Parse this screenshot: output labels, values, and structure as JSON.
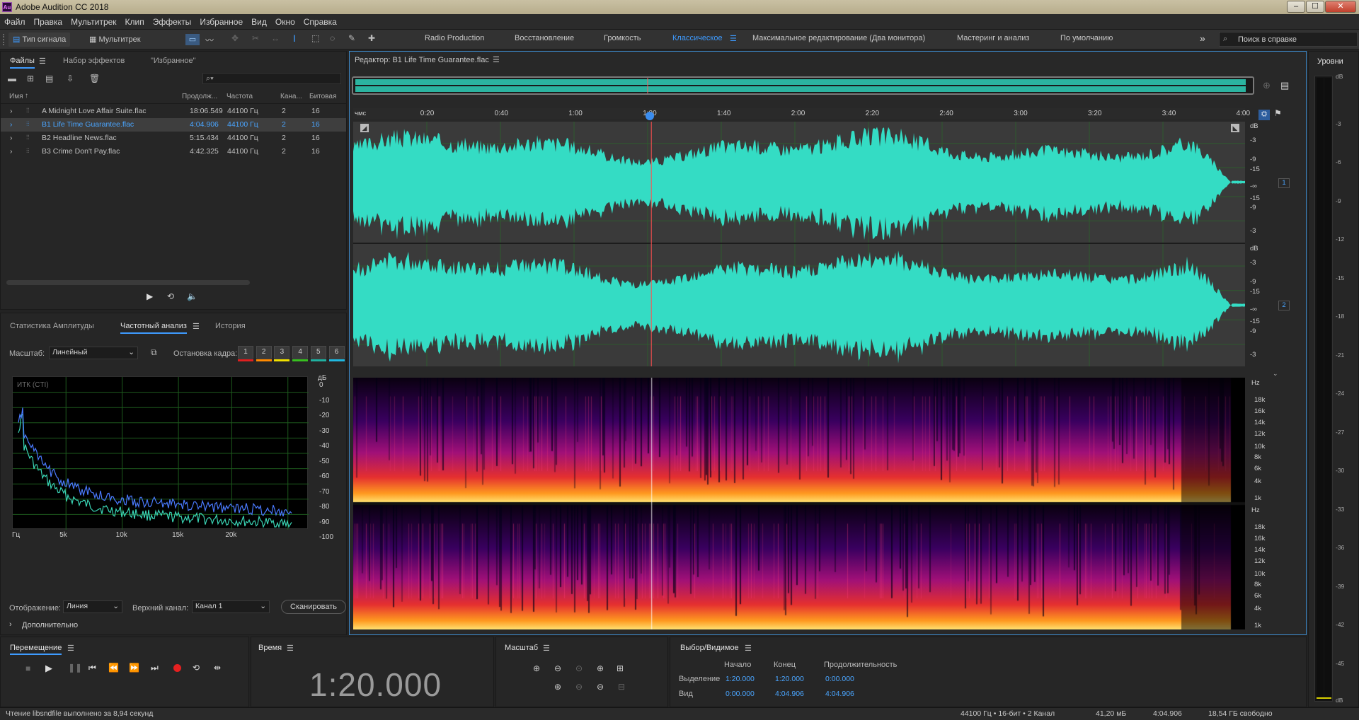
{
  "app": {
    "title": "Adobe Audition CC 2018",
    "logo": "Au"
  },
  "window_buttons": {
    "minimize": "‒",
    "maximize": "☐",
    "close": "✕"
  },
  "menu": [
    "Файл",
    "Правка",
    "Мультитрек",
    "Клип",
    "Эффекты",
    "Избранное",
    "Вид",
    "Окно",
    "Справка"
  ],
  "toolbar": {
    "waveform_btn": "Тип сигнала",
    "multitrack_btn": "Мультитрек",
    "more": "»",
    "search_placeholder": "Поиск в справке"
  },
  "workspaces": [
    "Radio Production",
    "Восстановление",
    "Громкость",
    "Классическое",
    "Максимальное редактирование (Два монитора)",
    "Мастеринг и анализ",
    "По умолчанию"
  ],
  "active_workspace": "Классическое",
  "files_panel": {
    "tabs": [
      "Файлы",
      "Набор эффектов",
      "\"Избранное\""
    ],
    "columns": [
      "Имя",
      "Продолж...",
      "Частота",
      "Кана...",
      "Битовая"
    ],
    "search_icon": "⌕▾",
    "files": [
      {
        "name": "A Midnight Love Affair Suite.flac",
        "duration": "18:06.549",
        "rate": "44100 Гц",
        "channels": "2",
        "bits": "16"
      },
      {
        "name": "B1 Life Time Guarantee.flac",
        "duration": "4:04.906",
        "rate": "44100 Гц",
        "channels": "2",
        "bits": "16"
      },
      {
        "name": "B2 Headline News.flac",
        "duration": "5:15.434",
        "rate": "44100 Гц",
        "channels": "2",
        "bits": "16"
      },
      {
        "name": "B3 Crime Don't Pay.flac",
        "duration": "4:42.325",
        "rate": "44100 Гц",
        "channels": "2",
        "bits": "16"
      }
    ],
    "selected_index": 1
  },
  "analysis_panel": {
    "tabs": [
      "Статистика Амплитуды",
      "Частотный анализ",
      "История"
    ],
    "scale_label": "Масштаб:",
    "scale_value": "Линейный",
    "freeze_label": "Остановка кадра:",
    "freeze_buttons": [
      "1",
      "2",
      "3",
      "4",
      "5",
      "6"
    ],
    "freeze_colors": [
      "#e02020",
      "#ff8a00",
      "#f0e000",
      "#38c020",
      "#20b0a0",
      "#20b8e0"
    ],
    "plot_label": "ИТК (CTI)",
    "y_unit": "дБ",
    "y_ticks": [
      "0",
      "-10",
      "-20",
      "-30",
      "-40",
      "-50",
      "-60",
      "-70",
      "-80",
      "-90",
      "-100"
    ],
    "x_ticks": [
      "Гц",
      "5k",
      "10k",
      "15k",
      "20k"
    ],
    "display_label": "Отображение:",
    "display_value": "Линия",
    "channel_label": "Верхний канал:",
    "channel_value": "Канал 1",
    "scan_button": "Сканировать",
    "more_label": "Дополнительно"
  },
  "editor": {
    "title": "Редактор: B1 Life Time Guarantee.flac",
    "ruler_unit": "чмс",
    "ruler_ticks": [
      "0:20",
      "0:40",
      "1:00",
      "1:20",
      "1:40",
      "2:00",
      "2:20",
      "2:40",
      "3:00",
      "3:20",
      "3:40",
      "4:00"
    ],
    "db_label": "dB",
    "db_ticks": [
      "-3",
      "-9",
      "-15",
      "-∞",
      "-15",
      "-9",
      "-3"
    ],
    "channel_badges": [
      "1",
      "2"
    ],
    "hz_label": "Hz",
    "hz_ticks": [
      "18k",
      "16k",
      "14k",
      "12k",
      "10k",
      "8k",
      "6k",
      "4k",
      "1k"
    ],
    "waveform_color": "#34dcc4",
    "playhead_color": "#ff5050"
  },
  "meters": {
    "title": "Уровни",
    "ticks": [
      "dB",
      "-3",
      "-6",
      "-9",
      "-12",
      "-15",
      "-18",
      "-21",
      "-24",
      "-27",
      "-30",
      "-33",
      "-36",
      "-39",
      "-42",
      "-45",
      "dB"
    ]
  },
  "transport": {
    "title": "Перемещение"
  },
  "time_panel": {
    "title": "Время",
    "value": "1:20.000"
  },
  "zoom_panel": {
    "title": "Масштаб"
  },
  "selection_panel": {
    "title": "Выбор/Видимое",
    "col_start": "Начало",
    "col_end": "Конец",
    "col_duration": "Продолжительность",
    "rows": [
      {
        "label": "Выделение",
        "start": "1:20.000",
        "end": "1:20.000",
        "duration": "0:00.000"
      },
      {
        "label": "Вид",
        "start": "0:00.000",
        "end": "4:04.906",
        "duration": "4:04.906"
      }
    ]
  },
  "status": {
    "message": "Чтение libsndfile выполнено за 8,94 секунд",
    "format": "44100 Гц • 16-бит • 2 Канал",
    "size": "41,20 мБ",
    "duration": "4:04.906",
    "free": "18,54 ГБ свободно"
  }
}
